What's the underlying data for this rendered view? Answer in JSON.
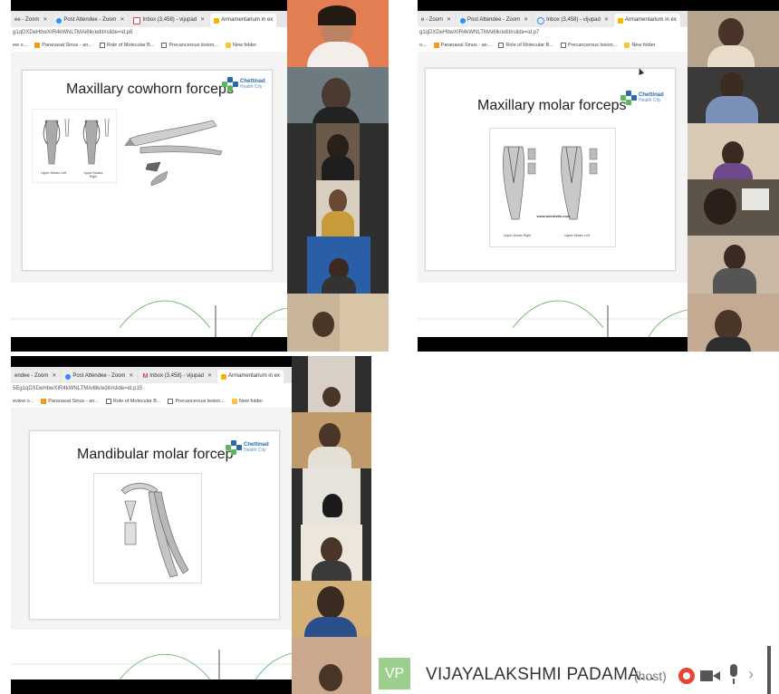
{
  "panels": [
    {
      "tabs": [
        "ee - Zoom",
        "Post Attendee - Zoom",
        "Inbox (3,458) - vijupad",
        "Armamentarium in ex"
      ],
      "url": "g1qDXDeHbwXIR4kWNLTMAi6lk/edit#slide=id.p8",
      "bookmarks": [
        "ew o...",
        "Paranasal Sinus - an...",
        "Role of Molecular B...",
        "Precancerous lesion...",
        "",
        "New folder"
      ],
      "slide_title": "Maxillary cowhorn forceps",
      "captions": [
        "Upper Molars Left",
        "Upper Molars Right"
      ]
    },
    {
      "tabs": [
        "e - Zoom",
        "Post Attendee - Zoom",
        "Inbox (3,458) - vijupad",
        "Armamentarium in ex"
      ],
      "url": "g1qDXDeHbwXIR4kWNLTMAi6lk/edit#slide=id.p7",
      "bookmarks": [
        "o...",
        "Paranasal Sinus - an...",
        "Role of Molecular B...",
        "Precancerous lesion...",
        "",
        "New folder"
      ],
      "slide_title": "Maxillary molar forceps",
      "website": "www.adentalls.com",
      "captions": [
        "Upper Molars Right",
        "Upper Molars Left"
      ]
    },
    {
      "tabs": [
        "endee - Zoom",
        "Post Attendee - Zoom",
        "Inbox (3,458) - vijupad",
        "Armamentarium in ex"
      ],
      "url": "5Eg1qDXDeHbwXIR4kWNLTMAi6lk/edit#slide=id.p15",
      "bookmarks": [
        "eview o...",
        "Paranasal Sinus - an...",
        "Role of Molecular B...",
        "Precancerous lesion...",
        "",
        "New folder"
      ],
      "slide_title": "Mandibular molar forcep"
    }
  ],
  "logo": {
    "name": "Chettinad",
    "sub": "Health City"
  },
  "host_bar": {
    "initials": "VP",
    "name": "VIJAYALAKSHMI PADAMA...",
    "role": "(host)"
  },
  "colors": {
    "zoom_dark": "#2e2e2e",
    "logo_blue": "#2b6aa8",
    "curve_green": "#5bb05b",
    "host_avatar": "#9ccf8e",
    "record_red": "#ea4335"
  }
}
